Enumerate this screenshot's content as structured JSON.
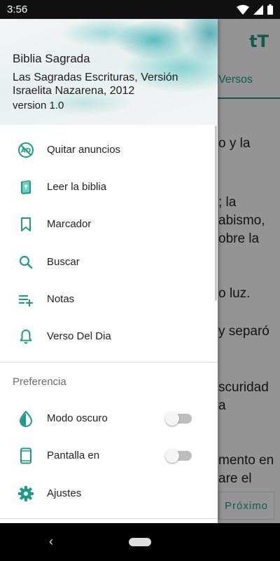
{
  "status": {
    "time": "3:56"
  },
  "background": {
    "font_size_icon": "tT",
    "tab_versos": "Versos",
    "lines": [
      "o y la",
      "; la",
      "abismo,",
      "obre la",
      "o luz.",
      "y separó",
      "scuridad",
      "a",
      "mento en",
      "are el"
    ],
    "next_label": "Próximo"
  },
  "drawer": {
    "app_title": "Biblia Sagrada",
    "subtitle": "Las Sagradas Escrituras, Versión Israelita Nazarena, 2012",
    "version": "version 1.0",
    "menu": [
      {
        "label": "Quitar anuncios",
        "icon": "no-ads-icon"
      },
      {
        "label": "Leer la biblia",
        "icon": "book-icon"
      },
      {
        "label": "Marcador",
        "icon": "bookmark-icon"
      },
      {
        "label": "Buscar",
        "icon": "search-icon"
      },
      {
        "label": "Notas",
        "icon": "playlist-add-icon"
      },
      {
        "label": "Verso Del Dia",
        "icon": "bell-icon"
      }
    ],
    "preferences_title": "Preferencia",
    "preferences": [
      {
        "label": "Modo oscuro",
        "icon": "contrast-icon",
        "toggle_on": false
      },
      {
        "label": "Pantalla en",
        "icon": "phone-icon",
        "toggle_on": false
      },
      {
        "label": "Ajustes",
        "icon": "gear-icon"
      }
    ]
  },
  "colors": {
    "accent": "#1e9b86",
    "scrim": "#000000",
    "statusbar": "#111111"
  }
}
